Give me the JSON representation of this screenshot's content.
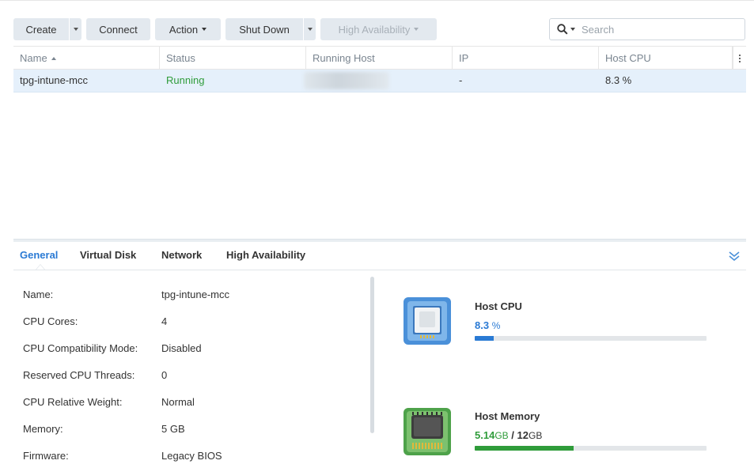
{
  "toolbar": {
    "create": "Create",
    "connect": "Connect",
    "action": "Action",
    "shutdown": "Shut Down",
    "high_availability": "High Availability"
  },
  "search": {
    "placeholder": "Search"
  },
  "grid": {
    "columns": [
      "Name",
      "Status",
      "Running Host",
      "IP",
      "Host CPU"
    ],
    "rows": [
      {
        "name": "tpg-intune-mcc",
        "status": "Running",
        "running_host": "",
        "ip": "-",
        "host_cpu": "8.3 %"
      }
    ]
  },
  "tabs": [
    "General",
    "Virtual Disk",
    "Network",
    "High Availability"
  ],
  "general": [
    {
      "key": "Name:",
      "value": "tpg-intune-mcc"
    },
    {
      "key": "CPU Cores:",
      "value": "4"
    },
    {
      "key": "CPU Compatibility Mode:",
      "value": "Disabled"
    },
    {
      "key": "Reserved CPU Threads:",
      "value": "0"
    },
    {
      "key": "CPU Relative Weight:",
      "value": "Normal"
    },
    {
      "key": "Memory:",
      "value": "5 GB"
    },
    {
      "key": "Firmware:",
      "value": "Legacy BIOS"
    }
  ],
  "metrics": {
    "cpu": {
      "title": "Host CPU",
      "value": "8.3",
      "unit": "%",
      "fraction": 0.083,
      "color": "#2a7ad4",
      "icon": "cpu-chip-icon"
    },
    "memory": {
      "title": "Host Memory",
      "used": "5.14",
      "used_unit": "GB",
      "separator": "/",
      "total": "12",
      "total_unit": "GB",
      "fraction": 0.428,
      "color": "#2f9c3a",
      "icon": "memory-module-icon"
    }
  },
  "colors": {
    "accent": "#2a7ad4",
    "running": "#2f9c3a",
    "selected_row": "#e5f0fb"
  }
}
